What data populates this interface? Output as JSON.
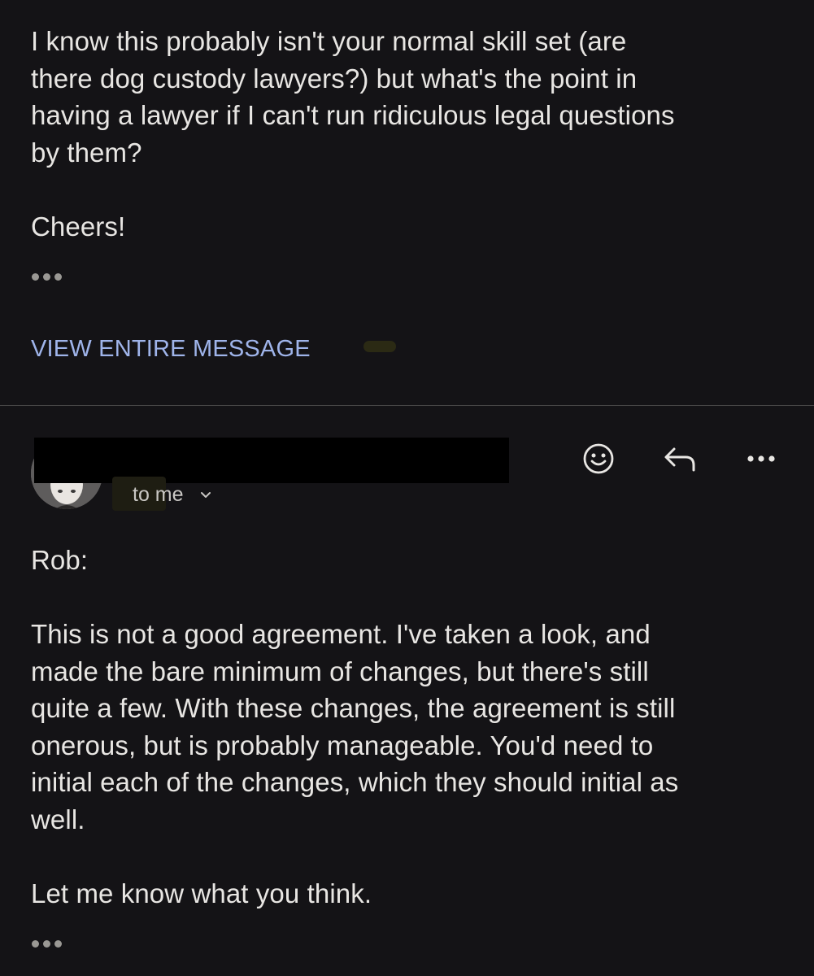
{
  "first_message": {
    "body": "I know this probably isn't your normal skill set  (are\nthere dog custody lawyers?) but what's the point in\nhaving a lawyer if I can't run ridiculous legal questions\nby them?",
    "signoff": "Cheers!",
    "view_entire_label": "VIEW ENTIRE MESSAGE"
  },
  "second_message": {
    "recipient_label": "to me",
    "actions": {
      "emoji_icon": "smiley-face-icon",
      "reply_icon": "reply-arrow-icon",
      "more_icon": "more-horizontal-icon"
    },
    "greeting": "Rob:",
    "body": "This is not a good agreement.  I've taken a look, and\nmade the bare minimum of changes, but there's still\nquite a few.  With these changes, the agreement is still\nonerous, but is probably manageable.  You'd need to\ninitial each of the changes, which they should initial as\nwell.",
    "closing": "Let me know what you think."
  },
  "colors": {
    "background": "#141316",
    "text": "#e8e6e3",
    "link": "#9fb4ea",
    "divider": "#4a4848"
  }
}
